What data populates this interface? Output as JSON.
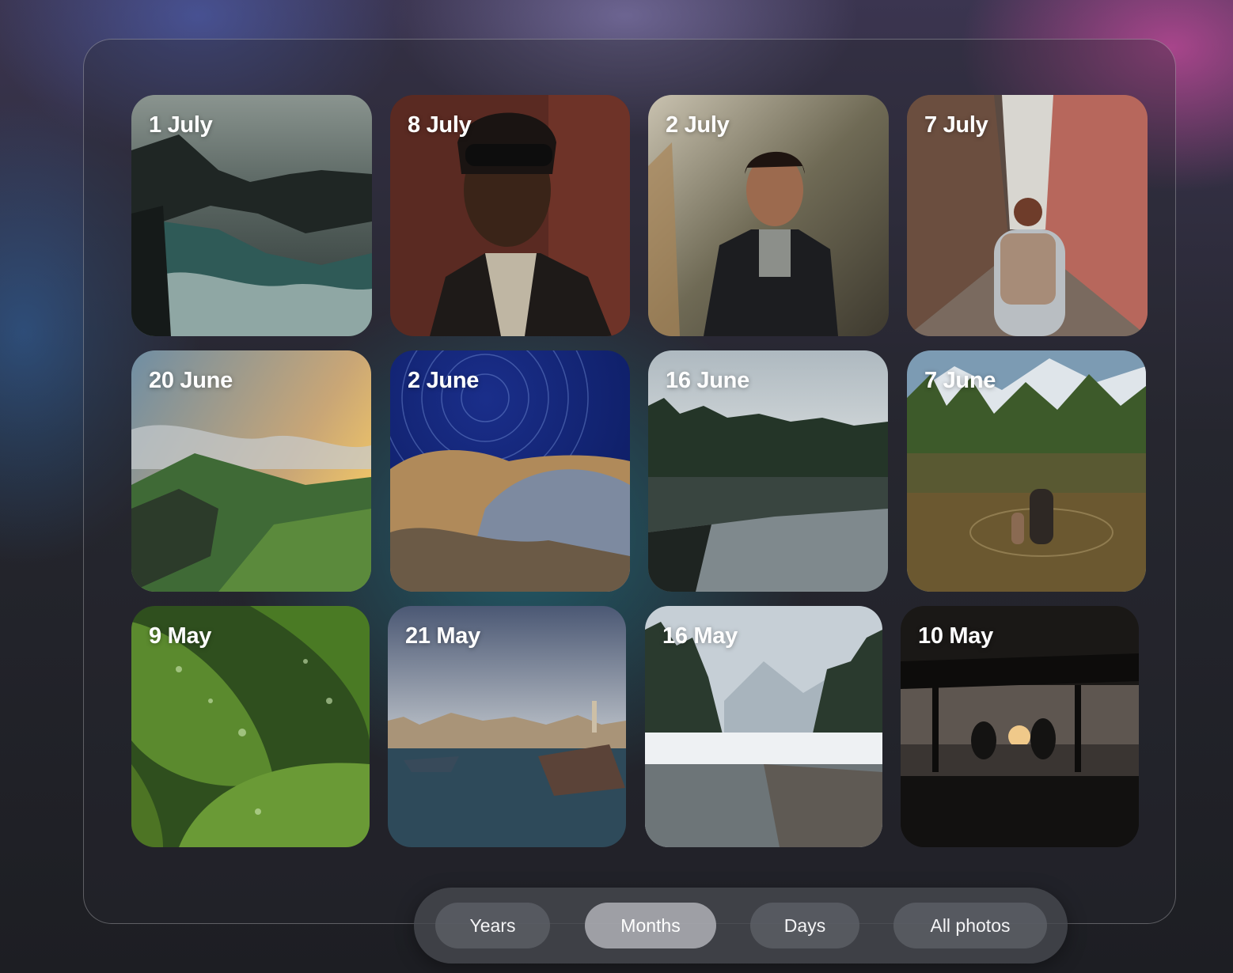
{
  "gallery": {
    "tiles": [
      {
        "label": "1 July",
        "scene": "coastal cliffs with crashing waves"
      },
      {
        "label": "8 July",
        "scene": "portrait of man with dreadlocks and sunglasses"
      },
      {
        "label": "2 July",
        "scene": "smiling man in jacket among dry plants"
      },
      {
        "label": "7 July",
        "scene": "woman with backpack walking narrow alley"
      },
      {
        "label": "20 June",
        "scene": "green valley cliffs at sunset"
      },
      {
        "label": "2 June",
        "scene": "star trails over rock formation"
      },
      {
        "label": "16 June",
        "scene": "forest reflected in calm lake"
      },
      {
        "label": "7 June",
        "scene": "mother and child wading in mountain lake"
      },
      {
        "label": "9 May",
        "scene": "green leaves with water droplets"
      },
      {
        "label": "21 May",
        "scene": "harbor with boats and city skyline"
      },
      {
        "label": "16 May",
        "scene": "snowy mountain lake with pine trees"
      },
      {
        "label": "10 May",
        "scene": "two people silhouetted at sunset under shelter"
      }
    ]
  },
  "view_switcher": {
    "options": [
      {
        "label": "Years",
        "active": false
      },
      {
        "label": "Months",
        "active": true
      },
      {
        "label": "Days",
        "active": false
      },
      {
        "label": "All photos",
        "active": false
      }
    ]
  }
}
